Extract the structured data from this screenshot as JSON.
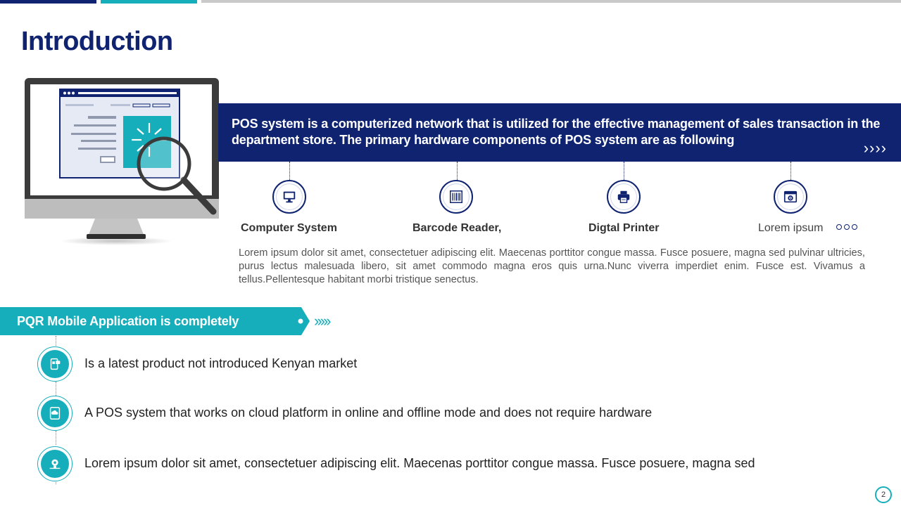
{
  "title": "Introduction",
  "banner": {
    "text": "POS system is a computerized network that is utilized for the effective management of sales transaction in the department store. The primary hardware components of POS system are as following",
    "arrows": "››››"
  },
  "hardware": [
    {
      "label": "Computer System",
      "icon": "computer-icon"
    },
    {
      "label": "Barcode Reader,",
      "icon": "barcode-icon"
    },
    {
      "label": "Digtal Printer",
      "icon": "printer-icon"
    },
    {
      "label": "Lorem ipsum",
      "icon": "settings-window-icon"
    }
  ],
  "paragraph": "Lorem ipsum dolor sit amet, consectetuer adipiscing elit. Maecenas porttitor congue massa. Fusce posuere, magna sed pulvinar ultricies, purus lectus malesuada libero, sit amet commodo magna eros quis urna.Nunc viverra imperdiet enim. Fusce est. Vivamus a tellus.Pellentesque habitant morbi tristique senectus.",
  "app_banner": {
    "text": "PQR Mobile Application is completely",
    "chevrons": "›››››"
  },
  "features": [
    {
      "text": "Is a latest product not introduced Kenyan market",
      "icon": "mobile-chat-icon"
    },
    {
      "text": "A POS system that works on cloud platform in online and offline mode and does not require hardware",
      "icon": "mobile-cloud-icon"
    },
    {
      "text": "Lorem ipsum dolor sit amet, consectetuer adipiscing elit. Maecenas porttitor congue massa. Fusce posuere, magna sed",
      "icon": "idea-gear-icon"
    }
  ],
  "page_number": "2",
  "colors": {
    "navy": "#0f2370",
    "teal": "#17aebb",
    "grey": "#c9c9c9"
  }
}
